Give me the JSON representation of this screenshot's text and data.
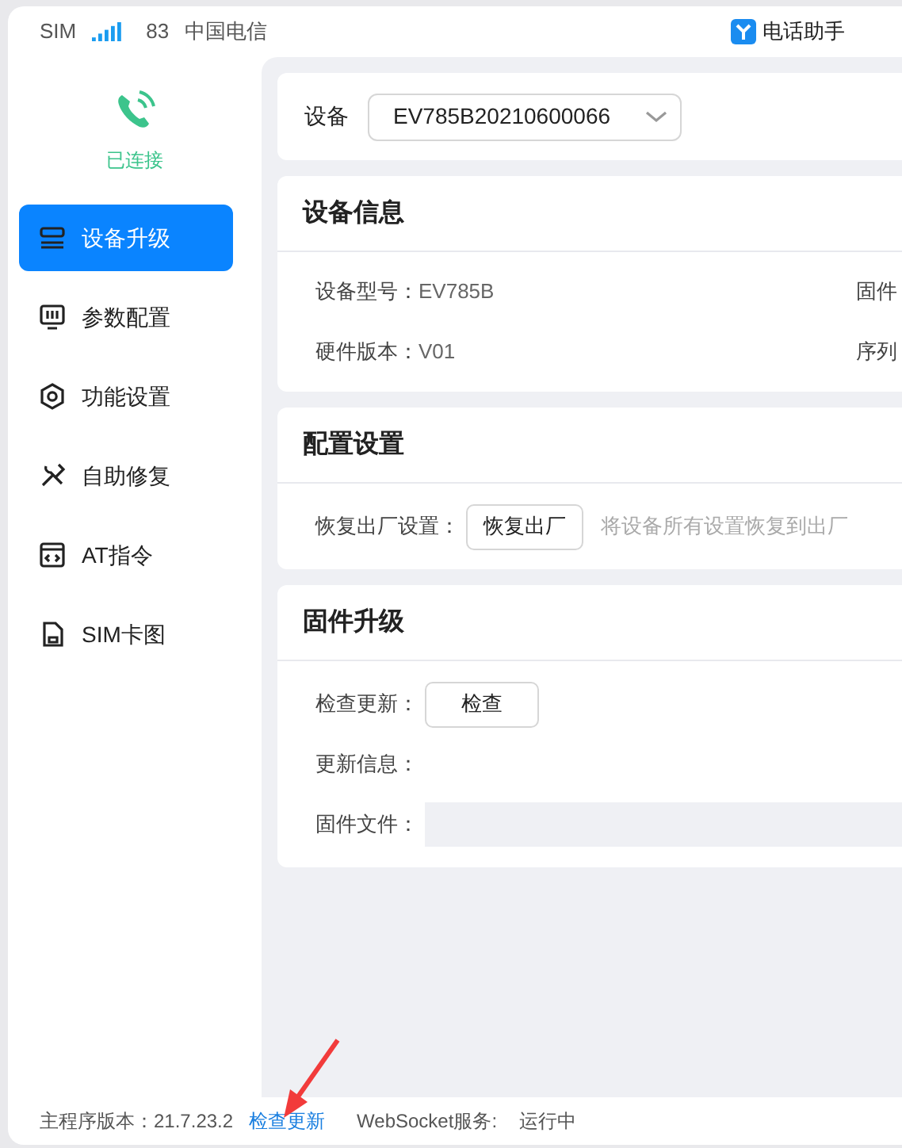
{
  "top_bar": {
    "sim_label": "SIM",
    "signal_value": "83",
    "carrier": "中国电信",
    "app_name": "电话助手"
  },
  "connection": {
    "status": "已连接",
    "connected": true
  },
  "sidebar": {
    "items": [
      {
        "label": "设备升级",
        "kind": "device",
        "selected": true
      },
      {
        "label": "参数配置",
        "kind": "sliders",
        "selected": false
      },
      {
        "label": "功能设置",
        "kind": "gear",
        "selected": false
      },
      {
        "label": "自助修复",
        "kind": "tools",
        "selected": false
      },
      {
        "label": "AT指令",
        "kind": "code",
        "selected": false
      },
      {
        "label": "SIM卡图",
        "kind": "sim",
        "selected": false
      }
    ]
  },
  "device_selector": {
    "label": "设备",
    "value": "EV785B20210600066"
  },
  "sections": [
    {
      "kind": "info",
      "title": "设备信息",
      "rows": [
        [
          {
            "label": "设备型号：",
            "value": "EV785B"
          },
          {
            "label": "固件"
          }
        ],
        [
          {
            "label": "硬件版本：",
            "value": "V01"
          },
          {
            "label": "序列"
          }
        ]
      ]
    },
    {
      "kind": "form",
      "title": "配置设置",
      "fields": [
        {
          "kind": "button",
          "label": "恢复出厂设置：",
          "button": "恢复出厂",
          "note": "将设备所有设置恢复到出厂"
        }
      ]
    },
    {
      "kind": "form",
      "title": "固件升级",
      "fields": [
        {
          "kind": "button",
          "label": "检查更新：",
          "button": "检查"
        },
        {
          "kind": "text",
          "label": "更新信息："
        },
        {
          "kind": "file",
          "label": "固件文件："
        }
      ]
    }
  ],
  "footer": {
    "version_label": "主程序版本：21.7.23.2",
    "update_link": "检查更新",
    "service_label": "WebSocket服务:",
    "service_status": "运行中"
  }
}
